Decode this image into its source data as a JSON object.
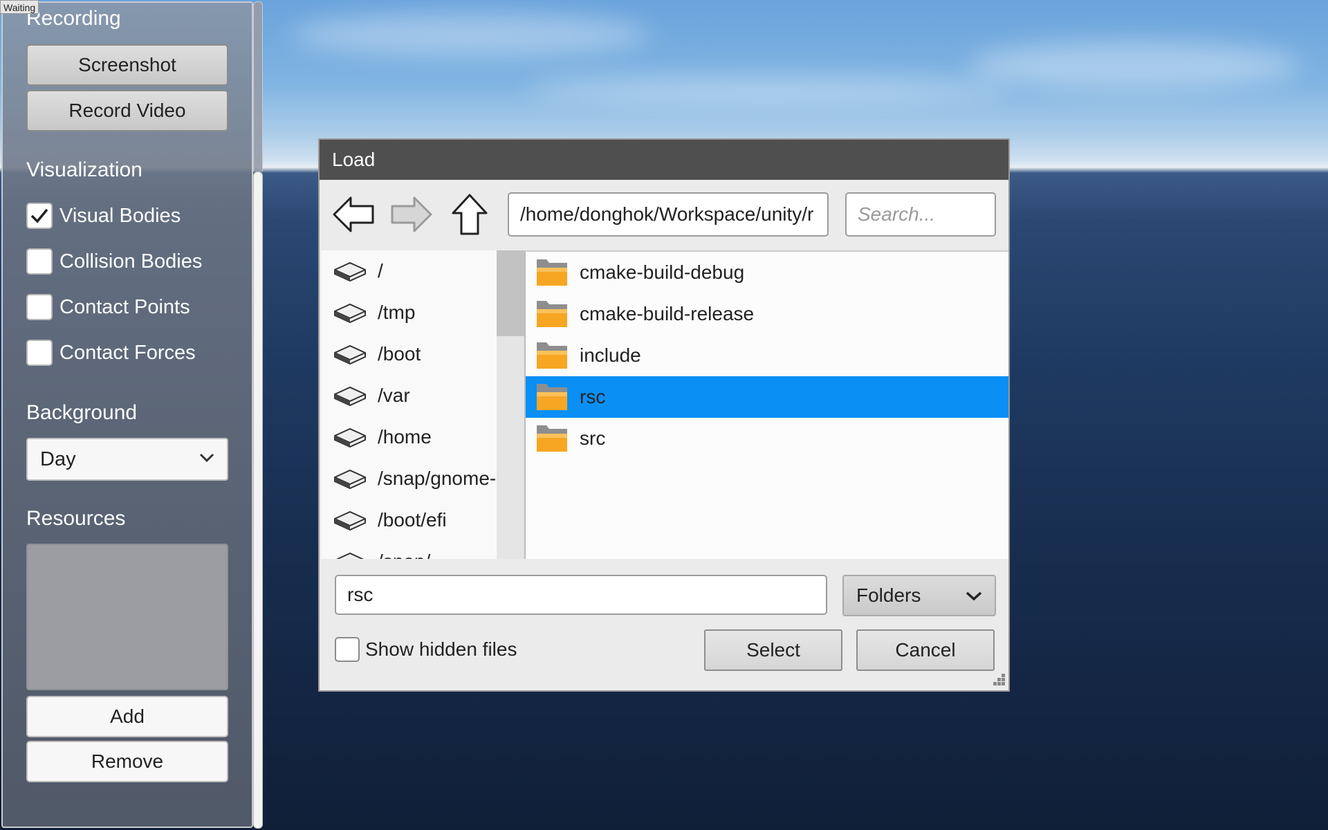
{
  "status": {
    "text": "Waiting"
  },
  "side_panel": {
    "recording_title": "Recording",
    "screenshot_button": "Screenshot",
    "record_video_button": "Record Video",
    "visualization_title": "Visualization",
    "visual_bodies": {
      "label": "Visual Bodies",
      "checked": true
    },
    "collision_bodies": {
      "label": "Collision Bodies",
      "checked": false
    },
    "contact_points": {
      "label": "Contact Points",
      "checked": false
    },
    "contact_forces": {
      "label": "Contact Forces",
      "checked": false
    },
    "background_title": "Background",
    "background_value": "Day",
    "resources_title": "Resources",
    "add_button": "Add",
    "remove_button": "Remove"
  },
  "dialog": {
    "title": "Load",
    "path": "/home/donghok/Workspace/unity/r",
    "search_placeholder": "Search...",
    "places": [
      "/",
      "/tmp",
      "/boot",
      "/var",
      "/home",
      "/snap/gnome-l",
      "/boot/efi",
      "/snap/..."
    ],
    "files": [
      {
        "name": "cmake-build-debug",
        "selected": false
      },
      {
        "name": "cmake-build-release",
        "selected": false
      },
      {
        "name": "include",
        "selected": false
      },
      {
        "name": "rsc",
        "selected": true
      },
      {
        "name": "src",
        "selected": false
      }
    ],
    "filename_value": "rsc",
    "filter_value": "Folders",
    "show_hidden_label": "Show hidden files",
    "show_hidden_checked": false,
    "select_button": "Select",
    "cancel_button": "Cancel"
  },
  "colors": {
    "selection": "#0a8ff5",
    "titlebar": "#4f4f4f",
    "folder": "#f6a623"
  }
}
